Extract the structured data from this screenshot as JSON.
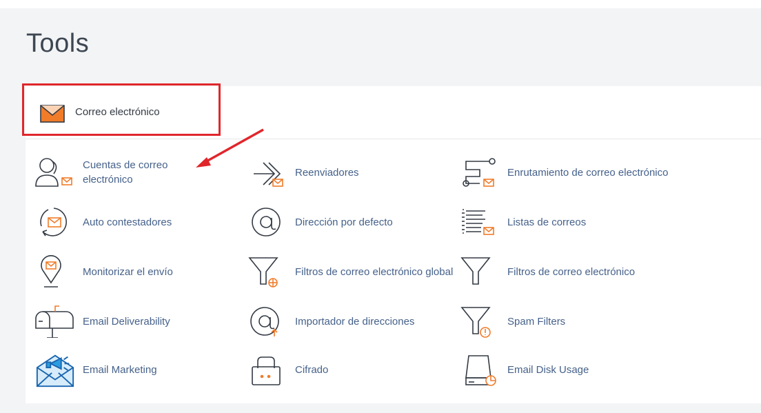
{
  "page": {
    "title": "Tools"
  },
  "section": {
    "label": "Correo electrónico"
  },
  "colors": {
    "accent": "#f07c2a",
    "highlight": "#e0262b",
    "link": "#45618a"
  },
  "tools": {
    "cuentas": {
      "label": "Cuentas de correo electrónico",
      "icon": "user-mail-icon"
    },
    "reenviadores": {
      "label": "Reenviadores",
      "icon": "forward-mail-icon"
    },
    "enrutamiento": {
      "label": "Enrutamiento de correo electrónico",
      "icon": "routing-mail-icon"
    },
    "auto": {
      "label": "Auto contestadores",
      "icon": "autoresponder-icon"
    },
    "direccion": {
      "label": "Dirección por defecto",
      "icon": "at-sign-icon"
    },
    "listas": {
      "label": "Listas de correos",
      "icon": "mailing-list-icon"
    },
    "monitorizar": {
      "label": "Monitorizar el envío",
      "icon": "track-delivery-icon"
    },
    "filtros_global": {
      "label": "Filtros de correo electrónico global",
      "icon": "global-filter-icon"
    },
    "filtros": {
      "label": "Filtros de correo electrónico",
      "icon": "filter-icon"
    },
    "deliverability": {
      "label": "Email Deliverability",
      "icon": "mailbox-icon"
    },
    "importador": {
      "label": "Importador de direcciones",
      "icon": "import-address-icon"
    },
    "spam": {
      "label": "Spam Filters",
      "icon": "spam-filter-icon"
    },
    "marketing": {
      "label": "Email Marketing",
      "icon": "email-marketing-icon"
    },
    "cifrado": {
      "label": "Cifrado",
      "icon": "encryption-icon"
    },
    "disk": {
      "label": "Email Disk Usage",
      "icon": "disk-usage-icon"
    }
  }
}
